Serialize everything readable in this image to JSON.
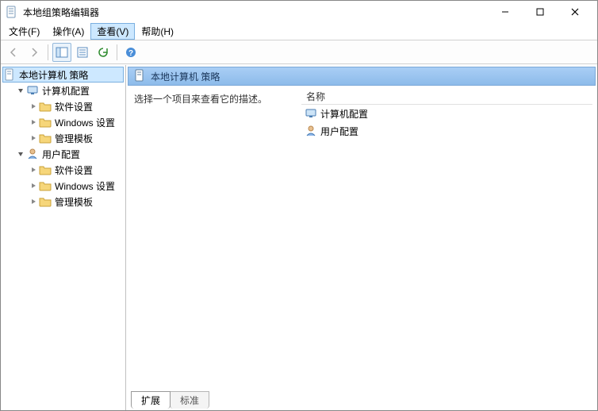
{
  "window": {
    "title": "本地组策略编辑器"
  },
  "menu": {
    "file": "文件(F)",
    "action": "操作(A)",
    "view": "查看(V)",
    "help": "帮助(H)"
  },
  "tree": {
    "root": "本地计算机 策略",
    "computer": "计算机配置",
    "computer_children": {
      "software": "软件设置",
      "windows": "Windows 设置",
      "admin": "管理模板"
    },
    "user": "用户配置",
    "user_children": {
      "software": "软件设置",
      "windows": "Windows 设置",
      "admin": "管理模板"
    }
  },
  "content": {
    "header": "本地计算机 策略",
    "description_prompt": "选择一个项目来查看它的描述。",
    "column_name": "名称",
    "items": {
      "computer": "计算机配置",
      "user": "用户配置"
    }
  },
  "tabs": {
    "extended": "扩展",
    "standard": "标准"
  }
}
